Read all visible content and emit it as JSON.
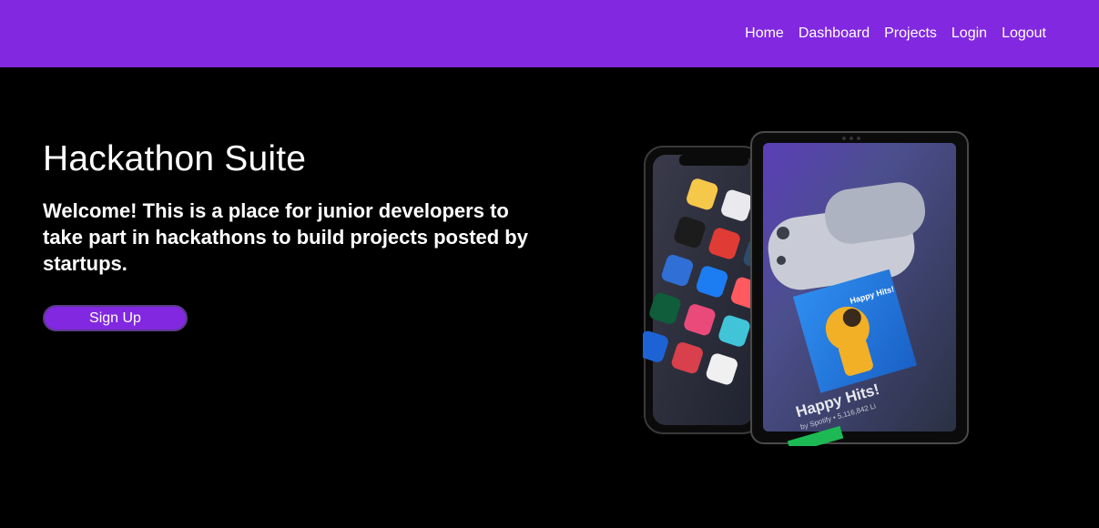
{
  "nav": {
    "items": [
      "Home",
      "Dashboard",
      "Projects",
      "Login",
      "Logout"
    ]
  },
  "hero": {
    "title": "Hackathon Suite",
    "subtitle": "Welcome! This is a place for junior developers to take part in hackathons to build projects posted by startups.",
    "cta_label": "Sign Up",
    "image_text": {
      "playlist_title": "Happy Hits!",
      "playlist_meta": "by Spotify • 5,116,842 Li",
      "cover_title": "Happy Hits!"
    }
  },
  "colors": {
    "brand": "#8128e0",
    "background": "#000000",
    "text": "#ffffff"
  }
}
